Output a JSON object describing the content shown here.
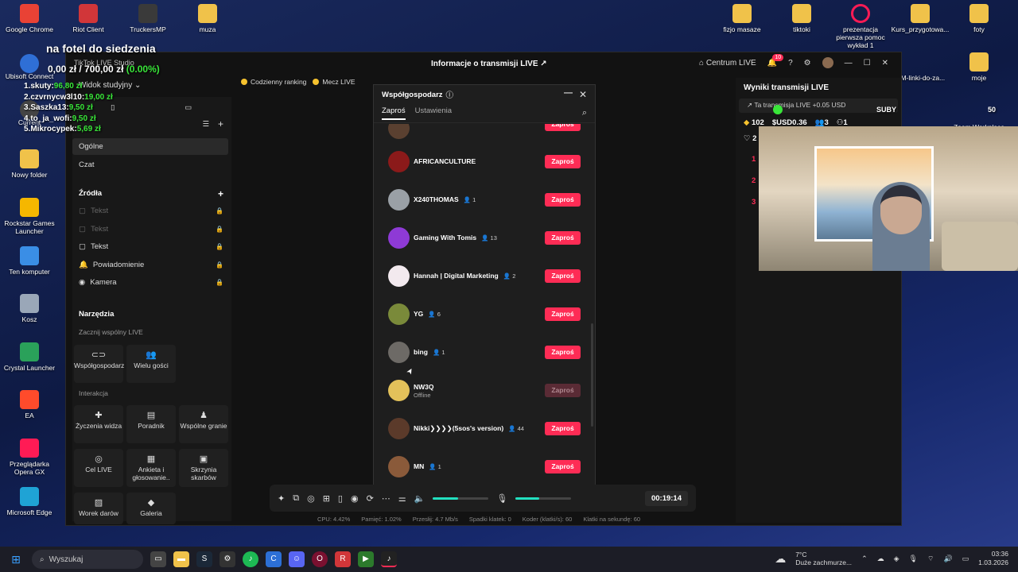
{
  "desktop": {
    "icons_left": [
      {
        "label": "Google Chrome",
        "icon": "chrome-icon",
        "color": "#e94235"
      },
      {
        "label": "Ubisoft Connect",
        "icon": "ubisoft-icon",
        "color": "#2f6fd6"
      },
      {
        "label": "Current",
        "icon": "current-icon",
        "color": "#444"
      },
      {
        "label": "Nowy folder",
        "icon": "folder-icon",
        "color": "#f0c24a"
      },
      {
        "label": "Rockstar Games Launcher",
        "icon": "rockstar-icon",
        "color": "#f5b700"
      },
      {
        "label": "Ten komputer",
        "icon": "computer-icon",
        "color": "#3a8ee6"
      },
      {
        "label": "Kosz",
        "icon": "recycle-bin-icon",
        "color": "#9aa7b8"
      },
      {
        "label": "Crystal Launcher",
        "icon": "crystal-icon",
        "color": "#2aa15a"
      },
      {
        "label": "EA",
        "icon": "ea-icon",
        "color": "#ff4b2b"
      },
      {
        "label": "Przeglądarka Opera GX",
        "icon": "opera-gx-icon",
        "color": "#ff1b55"
      },
      {
        "label": "Microsoft Edge",
        "icon": "edge-icon",
        "color": "#1fa3d5"
      }
    ],
    "icons_top": [
      {
        "label": "Riot Client",
        "icon": "riot-icon"
      },
      {
        "label": "TruckersMP",
        "icon": "truckersmp-icon"
      },
      {
        "label": "muza",
        "icon": "folder-icon"
      }
    ],
    "icons_right": [
      {
        "label": "fizjo masaze",
        "icon": "folder-icon"
      },
      {
        "label": "tiktoki",
        "icon": "folder-icon"
      },
      {
        "label": "prezentacja pierwsza pomoc wykład 1",
        "icon": "opera-icon"
      },
      {
        "label": "Kurs_przygotowa...",
        "icon": "folder-icon"
      },
      {
        "label": "foty",
        "icon": "folder-icon"
      },
      {
        "label": "OM-linki-do-za...",
        "icon": "opera-icon"
      },
      {
        "label": "moje",
        "icon": "folder-icon"
      },
      {
        "label": "Zoom Workplace",
        "icon": "zoom-icon"
      }
    ]
  },
  "overlay": {
    "title": "na fotel do siedzenia",
    "sum": "0,00 zł / 700,00 zł",
    "percent": "(0.00%)",
    "leaders": [
      {
        "name": "1.skuty:",
        "amount": "96,80 zł"
      },
      {
        "name": "2.czvrnycw3l10:",
        "amount": "19,00 zł"
      },
      {
        "name": "3.Saszka13:",
        "amount": "9,50 zł"
      },
      {
        "name": "4.to_ja_wofi:",
        "amount": "9,50 zł"
      },
      {
        "name": "5.Mikrocypek:",
        "amount": "5,69 zł"
      }
    ],
    "subs_label": "SUBY",
    "subs_count": "50"
  },
  "app": {
    "name": "TikTok LIVE Studio",
    "view_select": "Widok studyjny",
    "center_title": "Informacje o transmisji LIVE",
    "center_btn": "Centrum LIVE",
    "notif_count": "10",
    "pills": [
      "Codzienny ranking",
      "Mecz LIVE"
    ],
    "left": {
      "general": "Ogólne",
      "chat": "Czat",
      "sources_title": "Źródła",
      "sources": [
        {
          "label": "Tekst",
          "dim": true
        },
        {
          "label": "Tekst",
          "dim": true
        },
        {
          "label": "Tekst",
          "dim": false
        },
        {
          "label": "Powiadomienie",
          "dim": false
        },
        {
          "label": "Kamera",
          "dim": false
        }
      ],
      "tools_title": "Narzędzia",
      "start_shared": "Zacznij wspólny LIVE",
      "tools_shared": [
        {
          "label": "Współgospodarz",
          "icon": "link-icon"
        },
        {
          "label": "Wielu gości",
          "icon": "users-icon"
        }
      ],
      "interaction_title": "Interakcja",
      "tools_interaction": [
        {
          "label": "Życzenia widza",
          "icon": "wish-icon"
        },
        {
          "label": "Poradnik",
          "icon": "book-icon"
        },
        {
          "label": "Wspólne granie",
          "icon": "joystick-icon"
        },
        {
          "label": "Cel LIVE",
          "icon": "target-icon"
        },
        {
          "label": "Ankieta i głosowanie..",
          "icon": "poll-icon"
        },
        {
          "label": "Skrzynia skarbów",
          "icon": "chest-icon"
        },
        {
          "label": "Worek darów",
          "icon": "bag-icon"
        },
        {
          "label": "Galeria",
          "icon": "gallery-icon"
        }
      ]
    },
    "modal": {
      "title": "Współgospodarz",
      "tab_invite": "Zaproś",
      "tab_settings": "Ustawienia",
      "invite_label": "Zaproś",
      "users": [
        {
          "name": "AFRICANCULTURE",
          "count": "",
          "sub": "",
          "avatar": "#8b1a1a",
          "enabled": true
        },
        {
          "name": "X240THOMAS",
          "count": "1",
          "sub": "",
          "avatar": "#9aa0a6",
          "enabled": true
        },
        {
          "name": "Gaming With Tomis",
          "count": "13",
          "sub": "",
          "avatar": "#8e3ad6",
          "enabled": true
        },
        {
          "name": "Hannah | Digital Marketing",
          "count": "2",
          "sub": "",
          "avatar": "#f2e9ee",
          "enabled": true
        },
        {
          "name": "YG",
          "count": "6",
          "sub": "",
          "avatar": "#7a8a3a",
          "enabled": true
        },
        {
          "name": "bing",
          "count": "1",
          "sub": "",
          "avatar": "#6d6a66",
          "enabled": true
        },
        {
          "name": "NW3Q",
          "count": "",
          "sub": "Offline",
          "avatar": "#e3c15a",
          "enabled": false
        },
        {
          "name": "Nikki❯❯❯❯(5sos's version)",
          "count": "44",
          "sub": "",
          "avatar": "#5b3a2a",
          "enabled": true
        },
        {
          "name": "MN",
          "count": "1",
          "sub": "",
          "avatar": "#8a5a3a",
          "enabled": true
        }
      ]
    },
    "bottom": {
      "timer": "00:19:14",
      "volume_level": 0.45,
      "mic_level": 0.42,
      "stats": [
        "CPU: 4.42%",
        "Pamięć: 1.02%",
        "Przesłij: 4.7 Mb/s",
        "Spadki klatek: 0",
        "Koder (klatki/s): 60",
        "Klatki na sekundę: 60"
      ]
    },
    "right": {
      "title": "Wyniki transmisji LIVE",
      "promo": "Ta transmisja LIVE +0.05 USD",
      "diamonds": "102",
      "usd": "USD0.36",
      "viewers": "3",
      "gifters": "1",
      "likes": "2",
      "ranks": [
        "1",
        "2",
        "3"
      ]
    }
  },
  "taskbar": {
    "search": "Wyszukaj",
    "weather_temp": "7°C",
    "weather_desc": "Duże zachmurze...",
    "time": "03:36",
    "date": "1.03.2026"
  }
}
